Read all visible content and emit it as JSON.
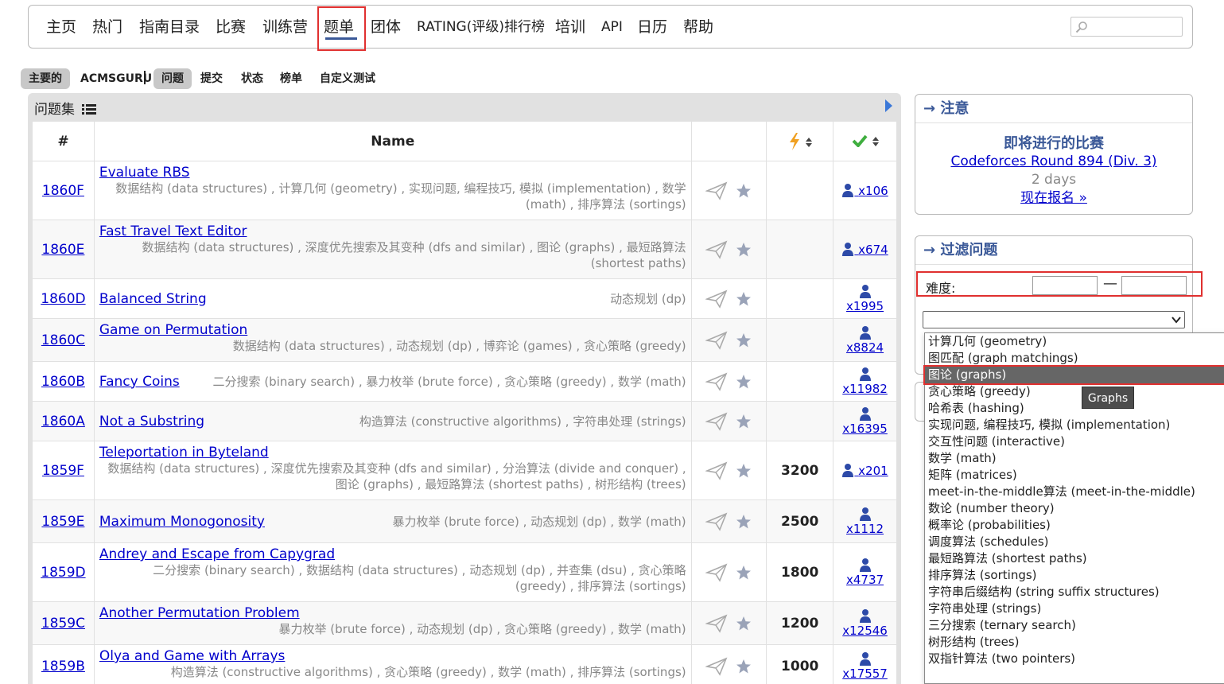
{
  "nav": {
    "items": [
      "主页",
      "热门",
      "指南目录",
      "比赛",
      "训练营",
      "题单",
      "团体",
      "RATING(评级)排行榜",
      "培训",
      "API",
      "日历",
      "帮助"
    ],
    "active": "题单"
  },
  "subnav": {
    "main": "主要的",
    "acmsguru": "ACMSGURU",
    "problems": "问题",
    "submit": "提交",
    "status": "状态",
    "standings": "榜单",
    "custom": "自定义测试"
  },
  "panel": {
    "title": "问题集",
    "headers": {
      "id": "#",
      "name": "Name"
    }
  },
  "problems": [
    {
      "id": "1860F",
      "name": "Evaluate RBS",
      "tags": "数据结构 (data structures) , 计算几何 (geometry) , 实现问题, 编程技巧, 模拟 (implementation) , 数学 (math) , 排序算法 (sortings)",
      "difficulty": "",
      "solved": "x106",
      "layout": "block"
    },
    {
      "id": "1860E",
      "name": "Fast Travel Text Editor",
      "tags": "数据结构 (data structures) , 深度优先搜索及其变种 (dfs and similar) , 图论 (graphs) , 最短路算法 (shortest paths)",
      "difficulty": "",
      "solved": "x674",
      "layout": "block"
    },
    {
      "id": "1860D",
      "name": "Balanced String",
      "tags": "动态规划 (dp)",
      "difficulty": "",
      "solved": "x1995",
      "layout": "inline"
    },
    {
      "id": "1860C",
      "name": "Game on Permutation",
      "tags": "数据结构 (data structures) , 动态规划 (dp) , 博弈论 (games) , 贪心策略 (greedy)",
      "difficulty": "",
      "solved": "x8824",
      "layout": "block"
    },
    {
      "id": "1860B",
      "name": "Fancy Coins",
      "tags": "二分搜索 (binary search) , 暴力枚举 (brute force) , 贪心策略 (greedy) , 数学 (math)",
      "difficulty": "",
      "solved": "x11982",
      "layout": "inline"
    },
    {
      "id": "1860A",
      "name": "Not a Substring",
      "tags": "构造算法 (constructive algorithms) , 字符串处理 (strings)",
      "difficulty": "",
      "solved": "x16395",
      "layout": "inline"
    },
    {
      "id": "1859F",
      "name": "Teleportation in Byteland",
      "tags": "数据结构 (data structures) , 深度优先搜索及其变种 (dfs and similar) , 分治算法 (divide and conquer) , 图论 (graphs) , 最短路算法 (shortest paths) , 树形结构 (trees)",
      "difficulty": "3200",
      "solved": "x201",
      "layout": "block"
    },
    {
      "id": "1859E",
      "name": "Maximum Monogonosity",
      "tags": "暴力枚举 (brute force) , 动态规划 (dp) , 数学 (math)",
      "difficulty": "2500",
      "solved": "x1112",
      "layout": "inline"
    },
    {
      "id": "1859D",
      "name": "Andrey and Escape from Capygrad",
      "tags": "二分搜索 (binary search) , 数据结构 (data structures) , 动态规划 (dp) , 并查集 (dsu) , 贪心策略 (greedy) , 排序算法 (sortings)",
      "difficulty": "1800",
      "solved": "x4737",
      "layout": "block"
    },
    {
      "id": "1859C",
      "name": "Another Permutation Problem",
      "tags": "暴力枚举 (brute force) , 动态规划 (dp) , 贪心策略 (greedy) , 数学 (math)",
      "difficulty": "1200",
      "solved": "x12546",
      "layout": "block"
    },
    {
      "id": "1859B",
      "name": "Olya and Game with Arrays",
      "tags": "构造算法 (constructive algorithms) , 贪心策略 (greedy) , 数学 (math) , 排序算法 (sortings)",
      "difficulty": "1000",
      "solved": "x17557",
      "layout": "block"
    }
  ],
  "notice": {
    "head": "→ 注意",
    "label": "即将进行的比赛",
    "contest": "Codeforces Round 894 (Div. 3)",
    "time": "2 days",
    "register": "现在报名 »"
  },
  "filter": {
    "head": "→ 过滤问题",
    "difficulty_label": "难度:",
    "dash": "—",
    "options": [
      "计算几何 (geometry)",
      "图匹配 (graph matchings)",
      "图论 (graphs)",
      "贪心策略 (greedy)",
      "哈希表 (hashing)",
      "实现问题, 编程技巧, 模拟 (implementation)",
      "交互性问题 (interactive)",
      "数学 (math)",
      "矩阵 (matrices)",
      "meet-in-the-middle算法 (meet-in-the-middle)",
      "数论 (number theory)",
      "概率论 (probabilities)",
      "调度算法 (schedules)",
      "最短路算法 (shortest paths)",
      "排序算法 (sortings)",
      "字符串后缀结构 (string suffix structures)",
      "字符串处理 (strings)",
      "三分搜索 (ternary search)",
      "树形结构 (trees)",
      "双指针算法 (two pointers)"
    ],
    "selected_index": 2,
    "tooltip": "Graphs"
  },
  "colors": {
    "accent": "#3b5998",
    "link": "#0000cc",
    "highlight": "#e0302f"
  }
}
